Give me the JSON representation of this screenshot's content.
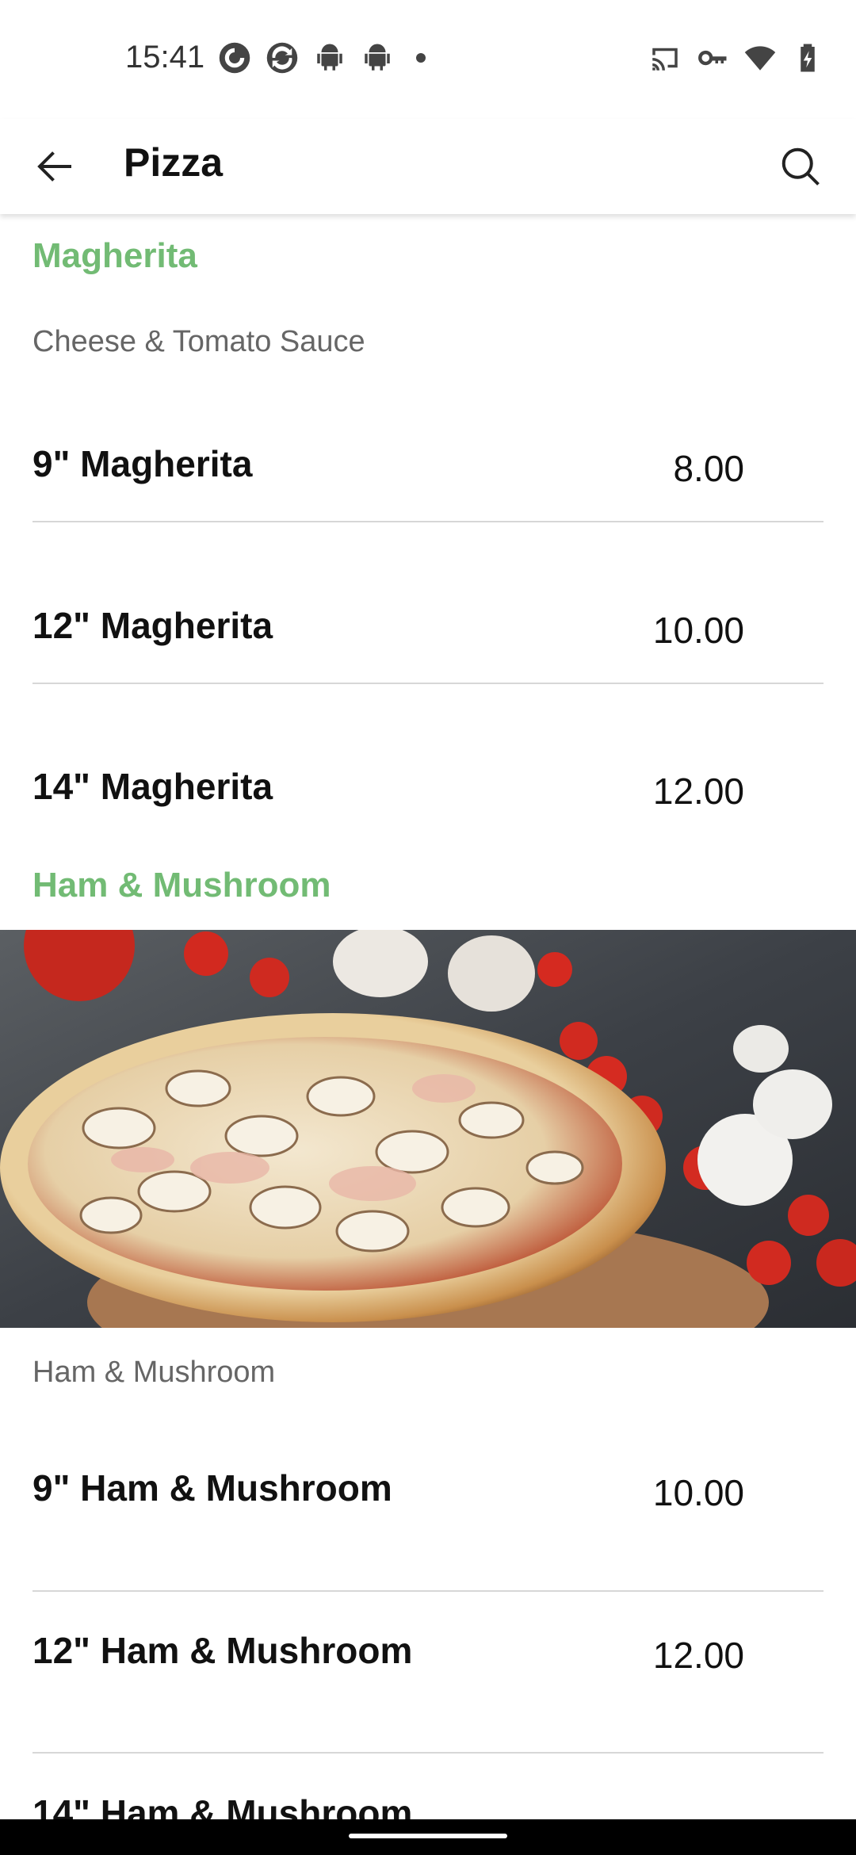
{
  "status_bar": {
    "time": "15:41",
    "left_icons": [
      "pocketcasts-icon",
      "sync-icon",
      "android-icon",
      "android-icon",
      "dot-icon"
    ],
    "right_icons": [
      "cast-icon",
      "vpn-key-icon",
      "wifi-icon",
      "battery-charging-icon"
    ]
  },
  "app_bar": {
    "title": "Pizza",
    "back_icon": "arrow-back-icon",
    "search_icon": "search-icon"
  },
  "sections": [
    {
      "title": "Magherita",
      "description": "Cheese & Tomato Sauce",
      "items": [
        {
          "name": "9\" Magherita",
          "price": "8.00"
        },
        {
          "name": "12\" Magherita",
          "price": "10.00"
        },
        {
          "name": "14\" Magherita",
          "price": "12.00"
        }
      ]
    },
    {
      "title": "Ham & Mushroom",
      "description": "Ham & Mushroom",
      "image": "ham-mushroom-pizza-photo",
      "items": [
        {
          "name": "9\" Ham & Mushroom",
          "price": "10.00"
        },
        {
          "name": "12\" Ham & Mushroom",
          "price": "12.00"
        },
        {
          "name": "14\" Ham & Mushroom",
          "price": ""
        }
      ]
    }
  ],
  "colors": {
    "section_title": "#72bb74",
    "divider": "#d7d7d7"
  }
}
